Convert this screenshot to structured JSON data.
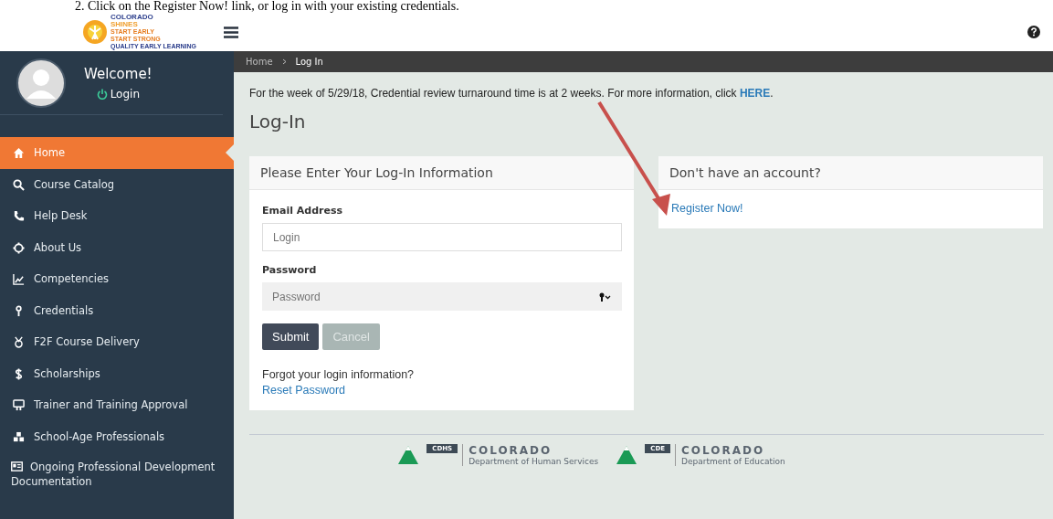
{
  "instruction": "2.  Click on the Register Now! link, or log in with your existing credentials.",
  "logo": {
    "lines": [
      "COLORADO",
      "SHINES",
      "START EARLY",
      "START STRONG",
      "QUALITY EARLY LEARNING"
    ]
  },
  "sidebar": {
    "welcome": "Welcome!",
    "login": "Login",
    "items": [
      {
        "label": "Home",
        "selected": true
      },
      {
        "label": "Course Catalog",
        "selected": false
      },
      {
        "label": "Help Desk",
        "selected": false
      },
      {
        "label": "About Us",
        "selected": false
      },
      {
        "label": "Competencies",
        "selected": false
      },
      {
        "label": "Credentials",
        "selected": false
      },
      {
        "label": "F2F Course Delivery",
        "selected": false
      },
      {
        "label": "Scholarships",
        "selected": false
      },
      {
        "label": "Trainer and Training Approval",
        "selected": false
      },
      {
        "label": "School-Age Professionals",
        "selected": false
      },
      {
        "label": "Ongoing Professional Development Documentation",
        "selected": false
      }
    ]
  },
  "breadcrumb": [
    "Home",
    "Log In"
  ],
  "notice": {
    "text": "For the week of 5/29/18, Credential review turnaround time is at 2 weeks.  For more information, click ",
    "link": "HERE",
    "end": "."
  },
  "page_title": "Log-In",
  "login_card": {
    "title": "Please Enter Your Log-In Information",
    "email_label": "Email Address",
    "email_placeholder": "Login",
    "password_label": "Password",
    "password_placeholder": "Password",
    "buttons": [
      {
        "label": "Submit",
        "disabled": false
      },
      {
        "label": "Cancel",
        "disabled": true
      }
    ],
    "forgot": "Forgot your login information?",
    "reset": "Reset Password"
  },
  "register_card": {
    "title": "Don't have an account?",
    "link": "Register Now!"
  },
  "footer": [
    {
      "badge": "CDHS",
      "name": "COLORADO",
      "dept": "Department of Human Services"
    },
    {
      "badge": "CDE",
      "name": "COLORADO",
      "dept": "Department of Education"
    }
  ]
}
